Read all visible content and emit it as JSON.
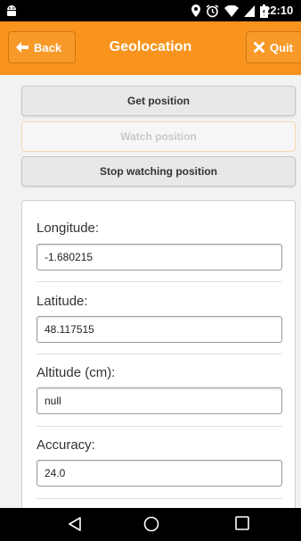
{
  "status_bar": {
    "time": "22:10",
    "icons": [
      "android-icon",
      "location-icon",
      "alarm-icon",
      "wifi-icon",
      "signal-icon",
      "battery-icon"
    ]
  },
  "header": {
    "title": "Geolocation",
    "back_label": "Back",
    "quit_label": "Quit",
    "color": "#f8941d"
  },
  "actions": {
    "get_position": "Get position",
    "watch_position": "Watch position",
    "stop_watching": "Stop watching position"
  },
  "fields": {
    "longitude": {
      "label": "Longitude:",
      "value": "-1.680215"
    },
    "latitude": {
      "label": "Latitude:",
      "value": "48.117515"
    },
    "altitude": {
      "label": "Altitude (cm):",
      "value": "null"
    },
    "accuracy": {
      "label": "Accuracy:",
      "value": "24.0"
    }
  },
  "nav_bar": {
    "icons": [
      "back-nav-icon",
      "home-nav-icon",
      "recents-nav-icon"
    ]
  }
}
